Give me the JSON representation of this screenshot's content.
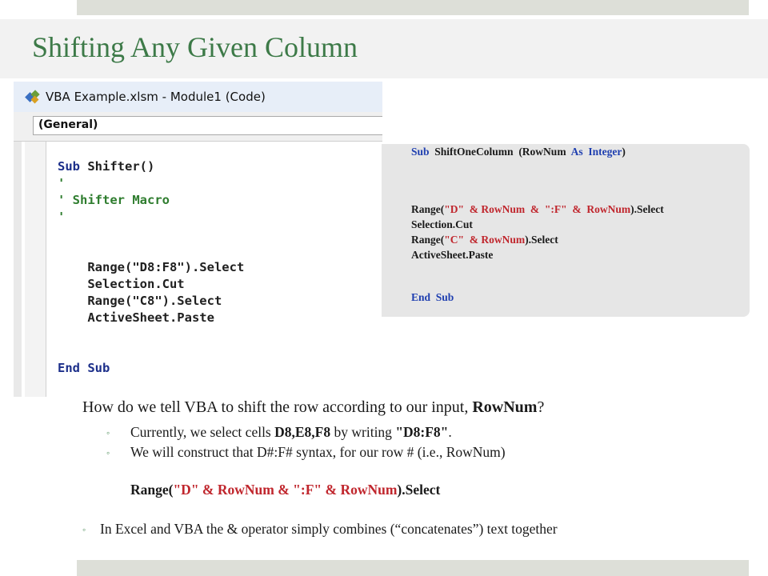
{
  "slide": {
    "title": "Shifting Any Given Column"
  },
  "vba_window": {
    "title": "VBA Example.xlsm - Module1 (Code)",
    "dropdown": "(General)",
    "code_lines": [
      {
        "kw": "Sub",
        "rest": " Shifter()"
      },
      {
        "cm": "'"
      },
      {
        "cm": "' Shifter Macro"
      },
      {
        "cm": "'"
      },
      {
        "rest": ""
      },
      {
        "rest": ""
      },
      {
        "rest": "    Range(\"D8:F8\").Select"
      },
      {
        "rest": "    Selection.Cut"
      },
      {
        "rest": "    Range(\"C8\").Select"
      },
      {
        "rest": "    ActiveSheet.Paste"
      }
    ],
    "end_line": "End Sub"
  },
  "code_panel": {
    "sub_kw": "Sub",
    "sub_name": "ShiftOneColumn",
    "sub_param_open": "(RowNum",
    "as_kw": "As",
    "type_kw": "Integer",
    "sub_close": ")",
    "line1_a": "Range(",
    "line1_b": "\"D\"  & RowNum  &  \":F\"  &  RowNum",
    "line1_c": ").Select",
    "line2": "Selection.Cut",
    "line3_a": "Range(",
    "line3_b": "\"C\"  & RowNum",
    "line3_c": ").Select",
    "line4": "ActiveSheet.Paste",
    "end_line": "End  Sub"
  },
  "body": {
    "question_a": "How do we tell VBA to shift the row according to our input, ",
    "question_b": "RowNum",
    "question_c": "?",
    "bullet1_a": "Currently, we select cells ",
    "bullet1_b": "D8,E8,F8",
    "bullet1_c": " by writing ",
    "bullet1_d": "\"D8:F8\"",
    "bullet1_e": ".",
    "bullet2": "We will construct that D#:F# syntax, for our row # (i.e., RowNum)",
    "range_a": "Range(",
    "range_b": "\"D\"  & RowNum  &  \":F\"  &  RowNum",
    "range_c": ").Select",
    "bullet3": "In Excel and VBA the & operator simply combines (“concatenates”)  text together"
  },
  "colors": {
    "title_green": "#3d7a48",
    "keyword_blue": "#1f3fb0",
    "string_red": "#c0262d"
  }
}
